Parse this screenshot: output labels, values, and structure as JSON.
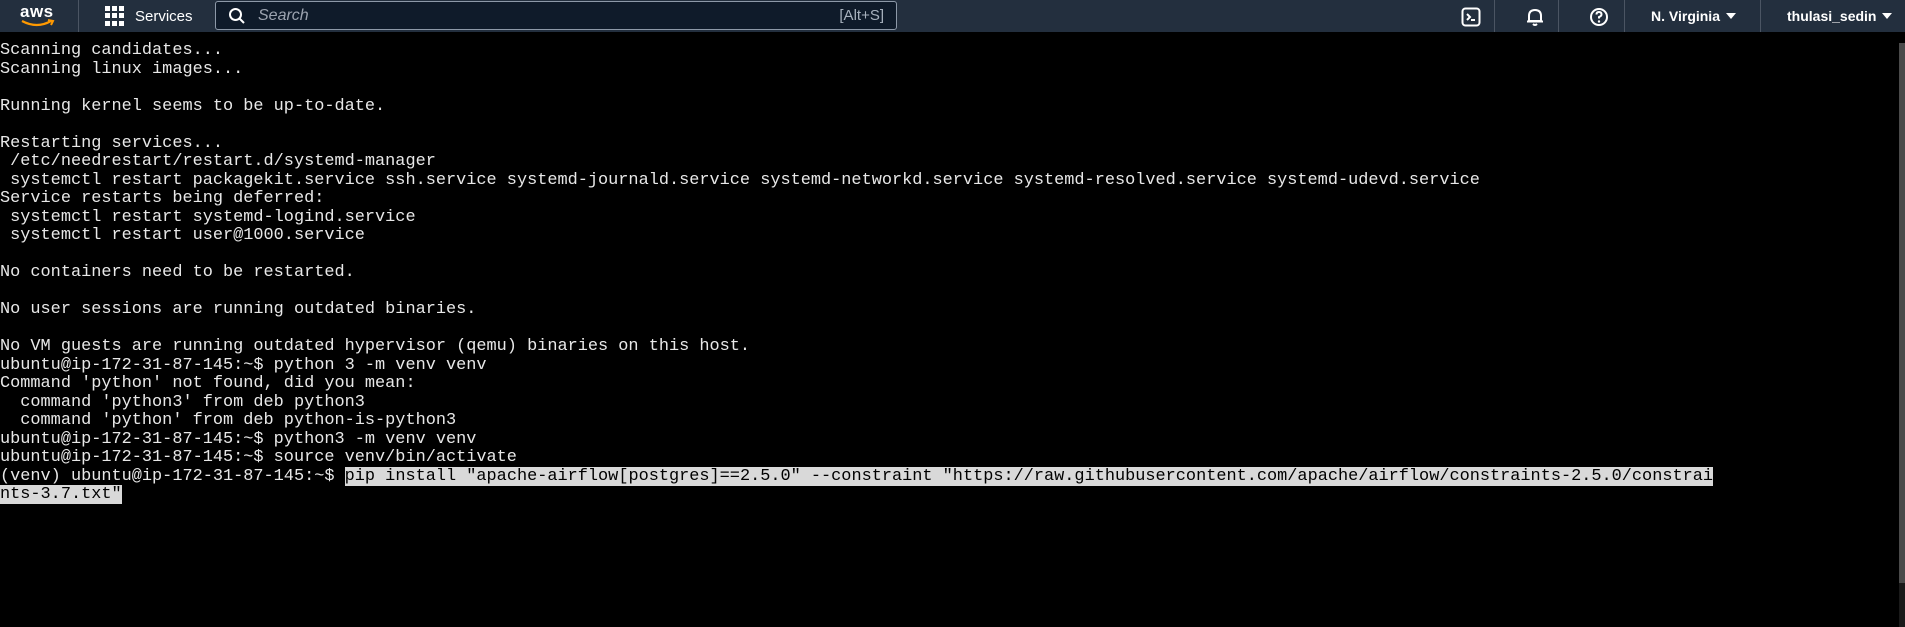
{
  "nav": {
    "logo": "aws",
    "services_label": "Services",
    "search_placeholder": "Search",
    "search_shortcut": "[Alt+S]",
    "region": "N. Virginia",
    "user": "thulasi_sedin"
  },
  "terminal": {
    "lines": [
      "Scanning candidates...",
      "Scanning linux images...",
      "",
      "Running kernel seems to be up-to-date.",
      "",
      "Restarting services...",
      " /etc/needrestart/restart.d/systemd-manager",
      " systemctl restart packagekit.service ssh.service systemd-journald.service systemd-networkd.service systemd-resolved.service systemd-udevd.service",
      "Service restarts being deferred:",
      " systemctl restart systemd-logind.service",
      " systemctl restart user@1000.service",
      "",
      "No containers need to be restarted.",
      "",
      "No user sessions are running outdated binaries.",
      "",
      "No VM guests are running outdated hypervisor (qemu) binaries on this host.",
      "ubuntu@ip-172-31-87-145:~$ python 3 -m venv venv",
      "Command 'python' not found, did you mean:",
      "  command 'python3' from deb python3",
      "  command 'python' from deb python-is-python3",
      "ubuntu@ip-172-31-87-145:~$ python3 -m venv venv",
      "ubuntu@ip-172-31-87-145:~$ source venv/bin/activate"
    ],
    "prompt": "(venv) ubuntu@ip-172-31-87-145:~$ ",
    "selected_command": "pip install \"apache-airflow[postgres]==2.5.0\" --constraint \"https://raw.githubusercontent.com/apache/airflow/constraints-2.5.0/constrai",
    "selected_wrap": "nts-3.7.txt\""
  },
  "colors": {
    "nav_bg": "#232f3e",
    "terminal_bg": "#000000",
    "selection_bg": "#d9d9d9"
  }
}
